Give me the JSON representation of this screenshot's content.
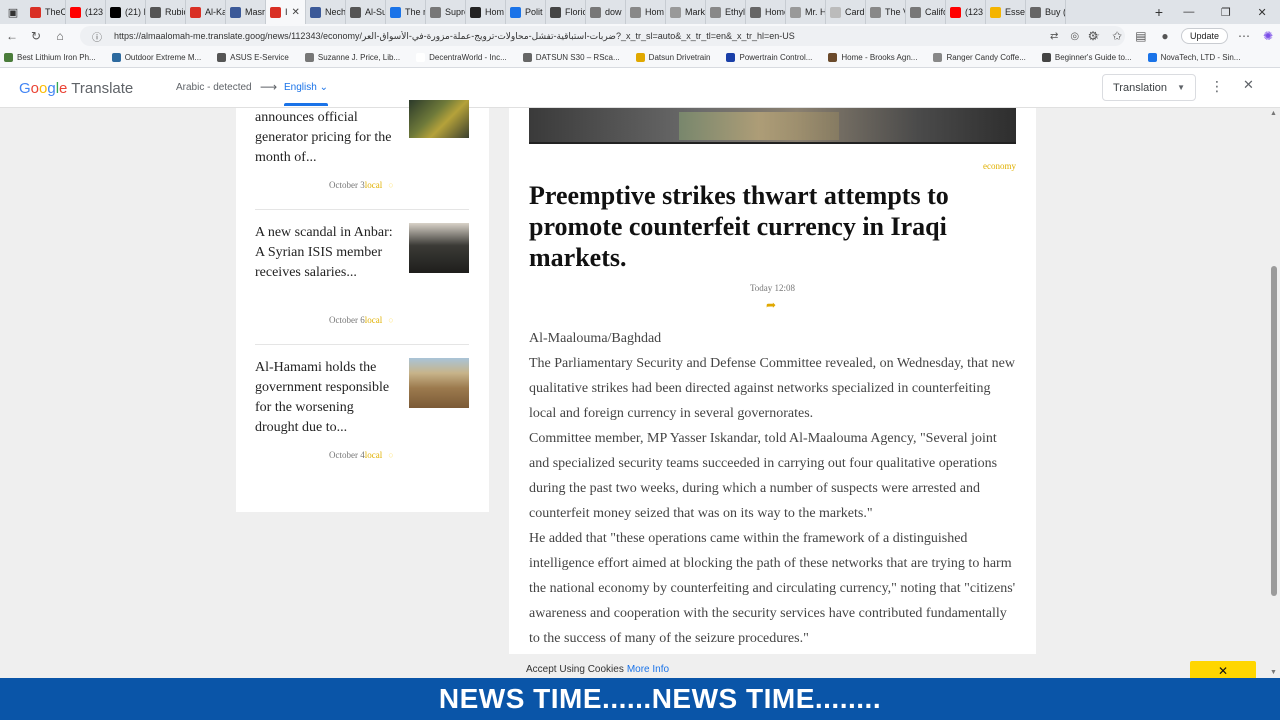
{
  "browser": {
    "tabs": [
      {
        "label": "TheC",
        "color": "#d93025"
      },
      {
        "label": "(123",
        "color": "#ff0000"
      },
      {
        "label": "(21) I",
        "color": "#000000"
      },
      {
        "label": "Rubic",
        "color": "#555555"
      },
      {
        "label": "Al-Ka",
        "color": "#d93025"
      },
      {
        "label": "Masr",
        "color": "#3b5998"
      },
      {
        "label": "I",
        "color": "#d93025",
        "active": true
      },
      {
        "label": "Nech",
        "color": "#3b5998"
      },
      {
        "label": "Al-Su",
        "color": "#555555"
      },
      {
        "label": "The r",
        "color": "#1a73e8"
      },
      {
        "label": "Supre",
        "color": "#777777"
      },
      {
        "label": "Hom",
        "color": "#222222"
      },
      {
        "label": "Polit",
        "color": "#1a73e8"
      },
      {
        "label": "Floric",
        "color": "#444444"
      },
      {
        "label": "dow",
        "color": "#777777"
      },
      {
        "label": "Hom",
        "color": "#888888"
      },
      {
        "label": "Mark",
        "color": "#999999"
      },
      {
        "label": "Ethyl",
        "color": "#888888"
      },
      {
        "label": "Home",
        "color": "#666666"
      },
      {
        "label": "Mr. H",
        "color": "#999999"
      },
      {
        "label": "Cardi",
        "color": "#bbbbbb"
      },
      {
        "label": "The V",
        "color": "#888888"
      },
      {
        "label": "Califo",
        "color": "#777777"
      },
      {
        "label": "(123",
        "color": "#ff0000"
      },
      {
        "label": "Essen",
        "color": "#f4b400"
      },
      {
        "label": "Buy (",
        "color": "#666666"
      }
    ],
    "new_tab": "+",
    "url": "https://almaalomah-me.translate.goog/news/112343/economy/ضربات-استباقية-تفشل-محاولات-ترويج-عملة-مزورة-في-الأسواق-العر?_x_tr_sl=auto&_x_tr_tl=en&_x_tr_hl=en-US",
    "update_label": "Update",
    "bookmarks": [
      {
        "label": "Best Lithium Iron Ph...",
        "color": "#4a7c3a"
      },
      {
        "label": "Outdoor Extreme M...",
        "color": "#2d6a9f"
      },
      {
        "label": "ASUS E-Service",
        "color": "#555555"
      },
      {
        "label": "Suzanne J. Price, Lib...",
        "color": "#777777"
      },
      {
        "label": "DecentraWorld - Inc...",
        "color": "#ffffff"
      },
      {
        "label": "DATSUN S30 – RSca...",
        "color": "#666666"
      },
      {
        "label": "Datsun Drivetrain",
        "color": "#e0a800"
      },
      {
        "label": "Powertrain Control...",
        "color": "#1a3fa8"
      },
      {
        "label": "Home - Brooks Agn...",
        "color": "#6b4a2b"
      },
      {
        "label": "Ranger Candy Coffe...",
        "color": "#888888"
      },
      {
        "label": "Beginner's Guide to...",
        "color": "#444444"
      },
      {
        "label": "NovaTech, LTD - Sin...",
        "color": "#1a73e8"
      }
    ]
  },
  "translate_bar": {
    "brand_word1": "Google",
    "brand_word2": "Translate",
    "source_lang": "Arabic - detected",
    "arrow": "⟶",
    "target_lang": "English",
    "mode_select": "Translation"
  },
  "sidebar": {
    "items": [
      {
        "title": "announces official generator pricing for the month of...",
        "date": "October 3",
        "category": "local"
      },
      {
        "title": "A new scandal in Anbar: A Syrian ISIS member receives salaries...",
        "date": "October 6",
        "category": "local"
      },
      {
        "title": "Al-Hamami holds the government responsible for the worsening drought due to...",
        "date": "October 4",
        "category": "local"
      }
    ]
  },
  "article": {
    "category": "economy",
    "title": "Preemptive strikes thwart attempts to promote counterfeit currency in Iraqi markets.",
    "date": "Today 12:08",
    "byline": "Al-Maalouma/Baghdad",
    "paragraphs": [
      "The Parliamentary Security and Defense Committee revealed, on Wednesday, that new qualitative strikes had been directed against networks specialized in counterfeiting local and foreign currency in several governorates.",
      "Committee member, MP Yasser Iskandar, told Al-Maalouma Agency, \"Several joint and specialized security teams succeeded in carrying out four qualitative operations during the past two weeks, during which a number of suspects were arrested and counterfeit money seized that was on its way to the markets.\"",
      "He added that \"these operations came within the framework of a distinguished intelligence effort aimed at blocking the path of these networks that are trying to harm the national economy by counterfeiting and circulating currency,\" noting that \"citizens' awareness and cooperation with the security services have contributed fundamentally to the success of many of the seizure procedures.\""
    ]
  },
  "cookie": {
    "text": "Accept Using Cookies",
    "more": "More Info",
    "close": "✕"
  },
  "ticker": {
    "text": "NEWS TIME......NEWS TIME........"
  }
}
